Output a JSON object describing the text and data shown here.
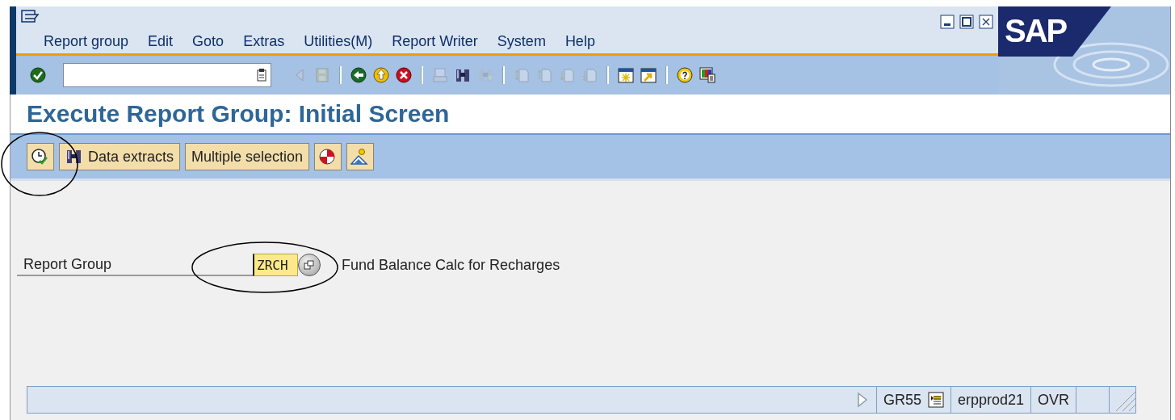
{
  "menu_bar": [
    {
      "label": "Report group"
    },
    {
      "label": "Edit"
    },
    {
      "label": "Goto"
    },
    {
      "label": "Extras"
    },
    {
      "label": "Utilities(M)"
    },
    {
      "label": "Report Writer"
    },
    {
      "label": "System"
    },
    {
      "label": "Help"
    }
  ],
  "logo": "SAP",
  "toolbar": [
    {
      "kind": "enter",
      "disabled": false
    },
    {
      "kind": "command-field"
    },
    {
      "kind": "triangle",
      "disabled": true
    },
    {
      "kind": "save",
      "disabled": true
    },
    {
      "kind": "separator"
    },
    {
      "kind": "back",
      "disabled": false
    },
    {
      "kind": "exit",
      "disabled": false
    },
    {
      "kind": "cancel",
      "disabled": false
    },
    {
      "kind": "separator"
    },
    {
      "kind": "print",
      "disabled": true
    },
    {
      "kind": "find",
      "disabled": false
    },
    {
      "kind": "find-next",
      "disabled": true
    },
    {
      "kind": "separator"
    },
    {
      "kind": "first-page",
      "disabled": true
    },
    {
      "kind": "prev-page",
      "disabled": true
    },
    {
      "kind": "next-page",
      "disabled": true
    },
    {
      "kind": "last-page",
      "disabled": true
    },
    {
      "kind": "separator"
    },
    {
      "kind": "new-session",
      "disabled": false
    },
    {
      "kind": "shortcut",
      "disabled": false
    },
    {
      "kind": "separator"
    },
    {
      "kind": "help",
      "disabled": false
    },
    {
      "kind": "layout",
      "disabled": false
    }
  ],
  "title": "Execute Report Group: Initial Screen",
  "app_toolbar": [
    {
      "kind": "execute"
    },
    {
      "kind": "find",
      "label": "Data extracts"
    },
    {
      "kind": "text",
      "label": "Multiple selection"
    },
    {
      "kind": "lifebuoy"
    },
    {
      "kind": "mountain"
    }
  ],
  "form": {
    "label": "Report Group",
    "value": "ZRCH",
    "description": "Fund Balance Calc for Recharges"
  },
  "status_bar": {
    "transaction": "GR55",
    "server": "erpprod21",
    "mode": "OVR"
  }
}
